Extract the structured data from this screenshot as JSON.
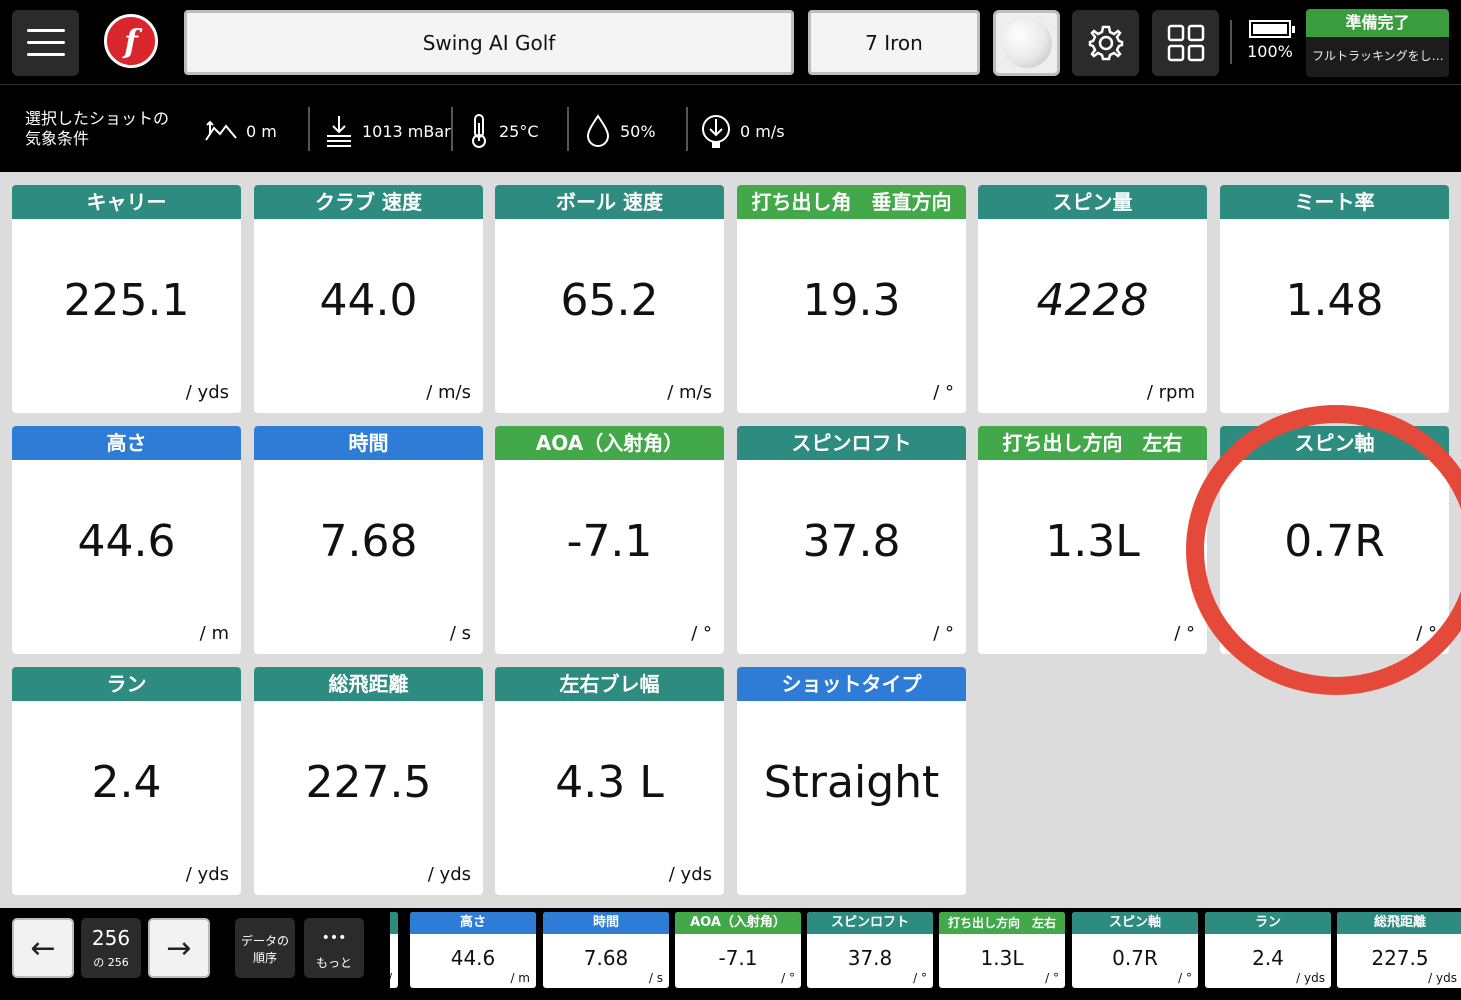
{
  "header": {
    "title": "Swing AI Golf",
    "club": "7 Iron",
    "battery": "100%",
    "status_title": "準備完了",
    "status_sub": "フルトラッキングをし…",
    "logo_letter": "f"
  },
  "weather": {
    "label_line1": "選択したショットの",
    "label_line2": "気象条件",
    "altitude": "0 m",
    "pressure": "1013 mBar",
    "temperature": "25°C",
    "humidity": "50%",
    "wind": "0 m/s"
  },
  "cards": [
    {
      "label": "キャリー",
      "value": "225.1",
      "unit": "/ yds",
      "color": "teal"
    },
    {
      "label": "クラブ 速度",
      "value": "44.0",
      "unit": "/ m/s",
      "color": "teal"
    },
    {
      "label": "ボール 速度",
      "value": "65.2",
      "unit": "/ m/s",
      "color": "teal"
    },
    {
      "label": "打ち出し角　垂直方向",
      "value": "19.3",
      "unit": "/ °",
      "color": "green"
    },
    {
      "label": "スピン量",
      "value": "4228",
      "unit": "/ rpm",
      "color": "teal"
    },
    {
      "label": "ミート率",
      "value": "1.48",
      "unit": "",
      "color": "teal"
    },
    {
      "label": "高さ",
      "value": "44.6",
      "unit": "/ m",
      "color": "blue"
    },
    {
      "label": "時間",
      "value": "7.68",
      "unit": "/ s",
      "color": "blue"
    },
    {
      "label": "AOA（入射角）",
      "value": "-7.1",
      "unit": "/ °",
      "color": "green"
    },
    {
      "label": "スピンロフト",
      "value": "37.8",
      "unit": "/ °",
      "color": "teal"
    },
    {
      "label": "打ち出し方向　左右",
      "value": "1.3L",
      "unit": "/ °",
      "color": "green"
    },
    {
      "label": "スピン軸",
      "value": "0.7R",
      "unit": "/ °",
      "color": "teal"
    },
    {
      "label": "ラン",
      "value": "2.4",
      "unit": "/ yds",
      "color": "teal"
    },
    {
      "label": "総飛距離",
      "value": "227.5",
      "unit": "/ yds",
      "color": "teal"
    },
    {
      "label": "左右ブレ幅",
      "value": "4.3 L",
      "unit": "/ yds",
      "color": "teal"
    },
    {
      "label": "ショットタイプ",
      "value": "Straight",
      "unit": "",
      "color": "blue"
    }
  ],
  "footer": {
    "shot_number": "256",
    "shot_total": "の 256",
    "order_line1": "データの",
    "order_line2": "順序",
    "more_label": "もっと",
    "more_dots": "•••",
    "prev_arrow": "←",
    "next_arrow": "→",
    "strip": [
      {
        "label": "高さ",
        "value": "44.6",
        "unit": "/ m",
        "color": "blue"
      },
      {
        "label": "時間",
        "value": "7.68",
        "unit": "/ s",
        "color": "blue"
      },
      {
        "label": "AOA（入射角）",
        "value": "-7.1",
        "unit": "/ °",
        "color": "green"
      },
      {
        "label": "スピンロフト",
        "value": "37.8",
        "unit": "/ °",
        "color": "teal"
      },
      {
        "label": "打ち出し方向　左右",
        "value": "1.3L",
        "unit": "/ °",
        "color": "green"
      },
      {
        "label": "スピン軸",
        "value": "0.7R",
        "unit": "/ °",
        "color": "teal"
      },
      {
        "label": "ラン",
        "value": "2.4",
        "unit": "/ yds",
        "color": "teal"
      },
      {
        "label": "総飛距離",
        "value": "227.5",
        "unit": "/ yds",
        "color": "teal"
      }
    ]
  },
  "colors": {
    "teal": "#2e8b7f",
    "blue": "#2f7cd6",
    "green": "#43a84a",
    "status_green": "#3a9c3c",
    "highlight": "#e5493a"
  }
}
